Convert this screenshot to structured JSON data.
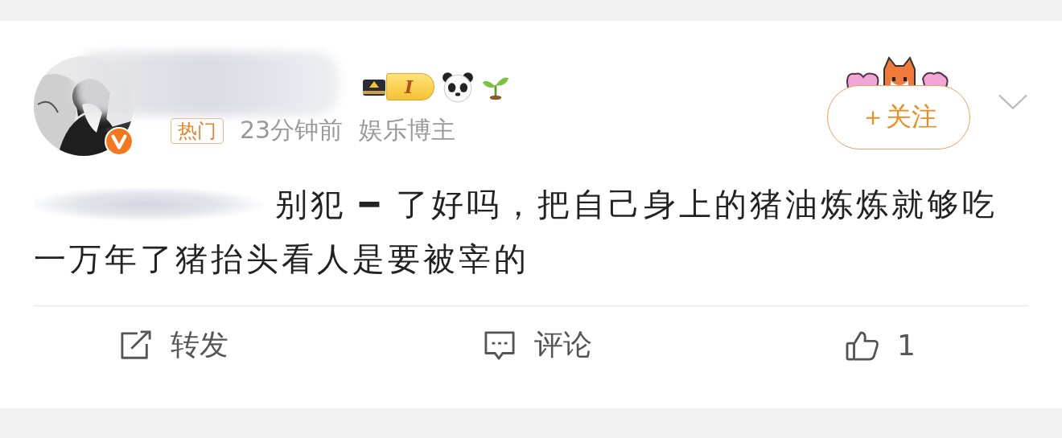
{
  "post": {
    "level_badge": "I",
    "tag": "热门",
    "time": "23分钟前",
    "author_role": "娱乐博主",
    "follow_button": "＋关注",
    "text": "别犯 ━ 了好吗，把自己身上的猪油炼炼就够吃一万年了猪抬头看人是要被宰的"
  },
  "actions": [
    {
      "kind": "repost",
      "label": "转发"
    },
    {
      "kind": "comment",
      "label": "评论"
    },
    {
      "kind": "like",
      "label": "1"
    }
  ]
}
